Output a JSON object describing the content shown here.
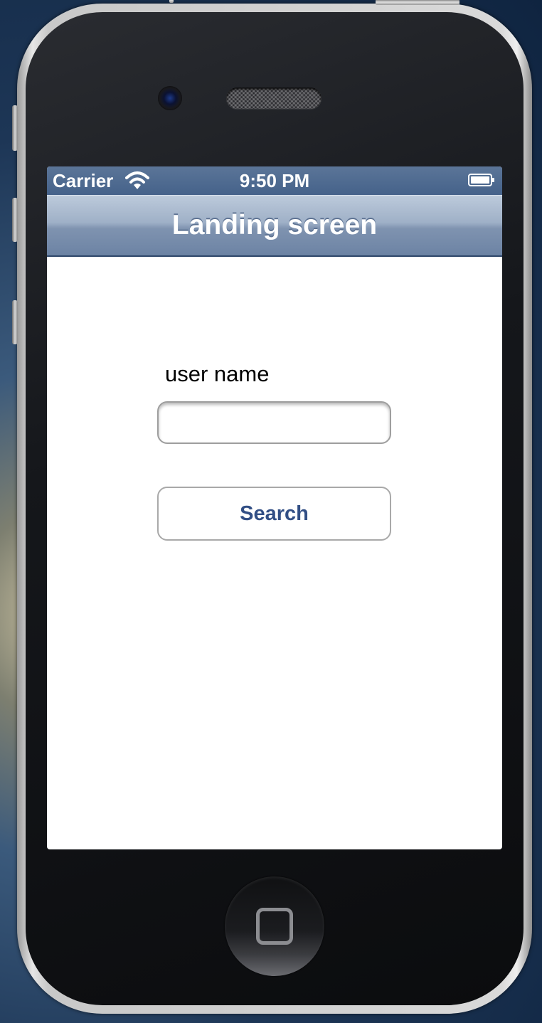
{
  "status_bar": {
    "carrier": "Carrier",
    "time": "9:50 PM",
    "wifi_icon": "wifi-icon",
    "battery_icon": "battery-icon"
  },
  "nav_bar": {
    "title": "Landing screen"
  },
  "form": {
    "username_label": "user name",
    "username_value": "",
    "username_placeholder": "",
    "search_button_label": "Search"
  },
  "device": {
    "home_button_icon": "home-button-icon",
    "camera_icon": "camera-icon",
    "speaker_icon": "speaker-grille-icon"
  },
  "colors": {
    "nav_bar": "#8ea0bb",
    "status_bar": "#4f6b91",
    "button_text": "#324f85",
    "screen_background": "#ffffff"
  }
}
